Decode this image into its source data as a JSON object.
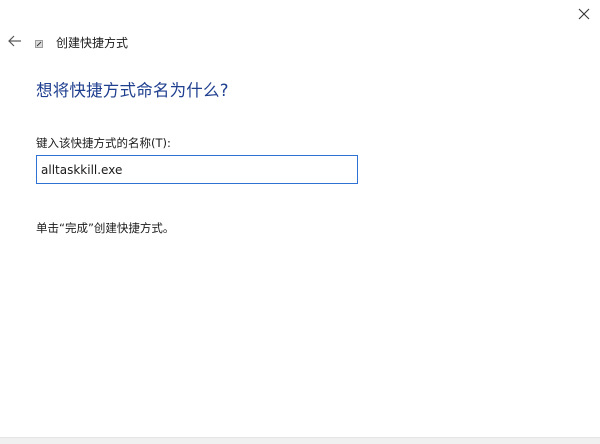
{
  "wizard": {
    "title": "创建快捷方式",
    "heading": "想将快捷方式命名为什么?",
    "field_label": "键入该快捷方式的名称(T):",
    "name_value": "alltaskkill.exe",
    "hint": "单击“完成”创建快捷方式。"
  },
  "icons": {
    "close": "close-icon",
    "back": "back-arrow-icon",
    "wizard": "shortcut-wizard-icon"
  },
  "colors": {
    "heading": "#1f3f8f",
    "input_border": "#2f72d6"
  }
}
